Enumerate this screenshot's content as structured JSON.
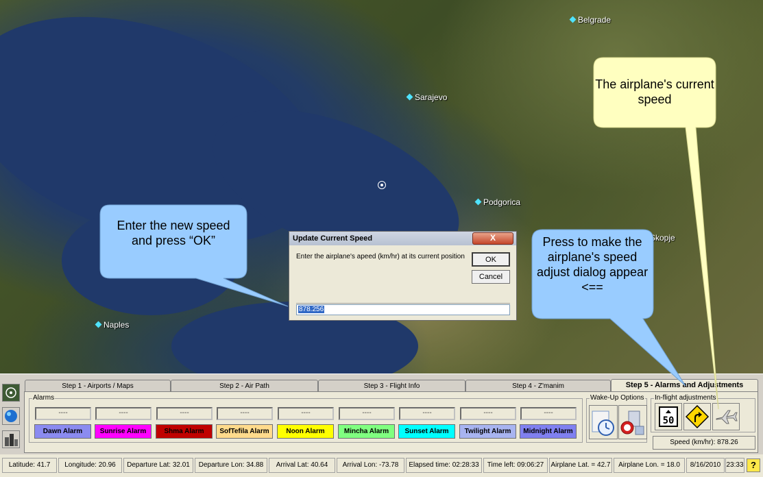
{
  "map": {
    "cities": [
      {
        "name": "Belgrade"
      },
      {
        "name": "Sarajevo"
      },
      {
        "name": "Podgorica"
      },
      {
        "name": "Skopje"
      },
      {
        "name": "Naples"
      }
    ]
  },
  "callouts": {
    "current_speed": "The airplane's current speed",
    "enter_speed": "Enter the new speed and press “OK”",
    "press_adjust": "Press to make the airplane's speed adjust dialog appear <=="
  },
  "dialog": {
    "title": "Update Current Speed",
    "close": "X",
    "message": "Enter the airplane's apeed (km/hr) at its current position",
    "ok": "OK",
    "cancel": "Cancel",
    "value": "878.256"
  },
  "tabs": [
    {
      "label": "Step 1 - Airports / Maps"
    },
    {
      "label": "Step 2 - Air Path"
    },
    {
      "label": "Step 3 - Flight Info"
    },
    {
      "label": "Step 4 - Z'manim"
    },
    {
      "label": "Step 5 - Alarms and Adjustments"
    }
  ],
  "alarms": {
    "group_label": "Alarms",
    "items": [
      {
        "value": "----",
        "label": "Dawn Alarm",
        "color": "#8b8bf0"
      },
      {
        "value": "----",
        "label": "Sunrise Alarm",
        "color": "#ff00ff"
      },
      {
        "value": "----",
        "label": "Shma Alarm",
        "color": "#c00000"
      },
      {
        "value": "----",
        "label": "SofTefila Alarm",
        "color": "#ffdb8c"
      },
      {
        "value": "----",
        "label": "Noon Alarm",
        "color": "#ffff00"
      },
      {
        "value": "----",
        "label": "Mincha Alarm",
        "color": "#80ff80"
      },
      {
        "value": "----",
        "label": "Sunset Alarm",
        "color": "#00ffff"
      },
      {
        "value": "----",
        "label": "Twilight Alarm",
        "color": "#a8b4f0"
      },
      {
        "value": "----",
        "label": "Midnight Alarm",
        "color": "#8080f0"
      }
    ]
  },
  "wakeup": {
    "label": "Wake-Up Options"
  },
  "inflight": {
    "label": "In-flight adjustments",
    "speed_sign": "50",
    "speed_readout": "Speed (km/hr): 878.26"
  },
  "status": [
    "Latitude: 41.7",
    "Longitude: 20.96",
    "Departure Lat: 32.01",
    "Departure Lon: 34.88",
    "Arrival Lat: 40.64",
    "Arrival Lon: -73.78",
    "Elapsed time: 02:28:33",
    "Time left: 09:06:27",
    "Airplane Lat. = 42.7",
    "Airplane Lon. = 18.0",
    "8/16/2010",
    "23:33"
  ],
  "help_glyph": "?"
}
